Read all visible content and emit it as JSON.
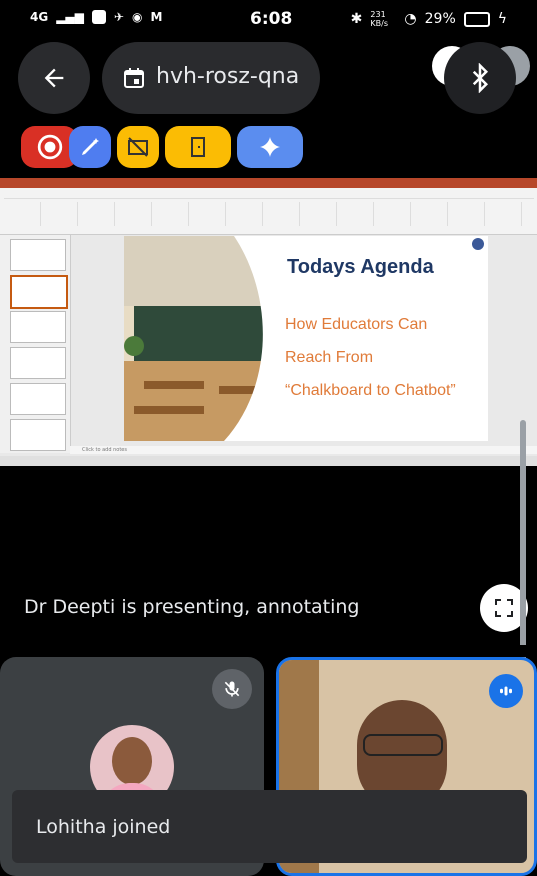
{
  "status_bar": {
    "network": "4G",
    "time": "6:08",
    "speed": "231 KB/s",
    "battery": "29%"
  },
  "header": {
    "meeting_code": "hvh-rosz-qna"
  },
  "toolbar": {
    "items": [
      "record-icon",
      "annotate-icon",
      "no-camera-icon",
      "exit-icon",
      "sparkle-icon"
    ]
  },
  "slide": {
    "title": "Todays Agenda",
    "lines": [
      "How Educators Can",
      "Reach From",
      "“Chalkboard to Chatbot”"
    ],
    "notes_placeholder": "Click to add notes"
  },
  "presenter": {
    "status_text": "Dr Deepti is presenting, annotating"
  },
  "toast": {
    "message": "Lohitha joined"
  },
  "colors": {
    "record": "#d93025",
    "annotate": "#4f7df0",
    "camera": "#fbbc04",
    "exit": "#fbbc04",
    "sparkle": "#5b8def",
    "slide_title": "#1f3864",
    "slide_orange": "#e07b39",
    "tile_border": "#1a73e8"
  }
}
